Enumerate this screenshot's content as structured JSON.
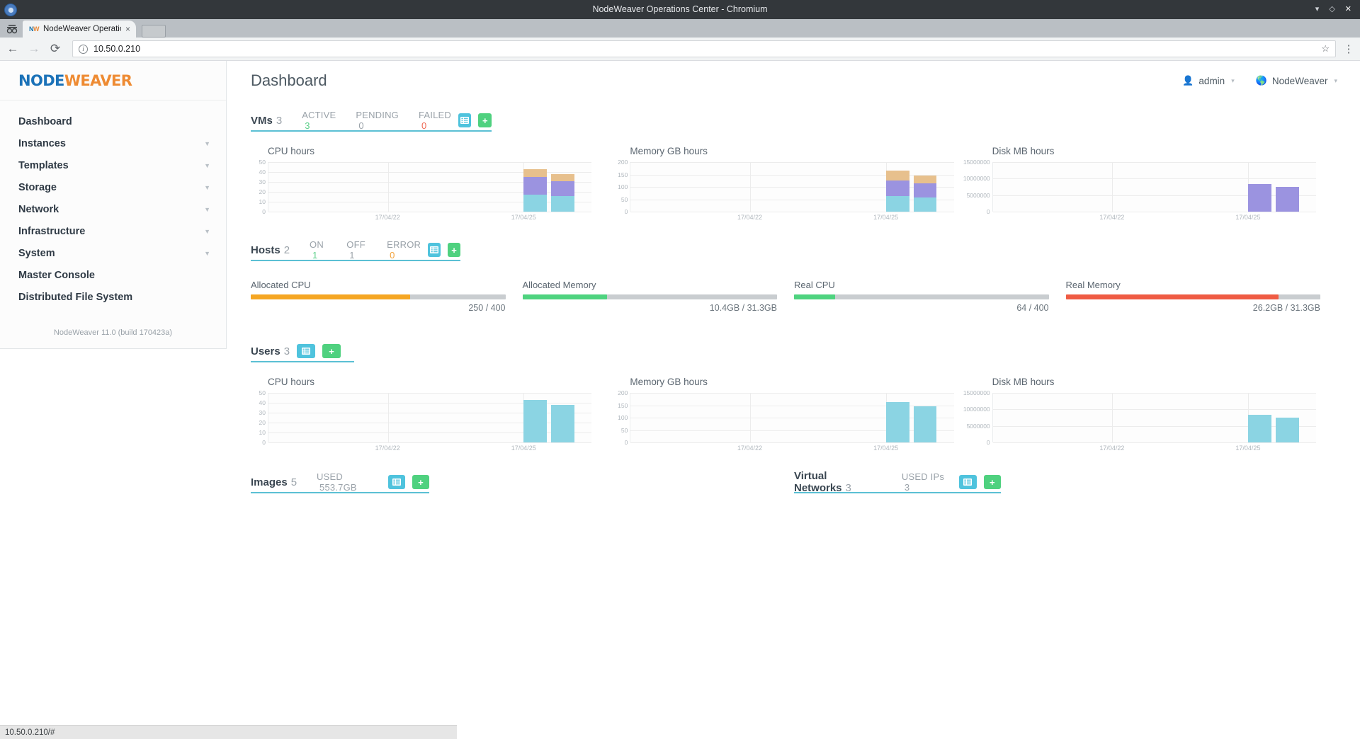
{
  "window": {
    "title": "NodeWeaver Operations Center - Chromium",
    "minimize_icon": "minimize-icon",
    "maximize_icon": "maximize-icon",
    "close_icon": "close-icon"
  },
  "browser": {
    "tab_title": "NodeWeaver Operatic",
    "favicon_text_a": "NW",
    "favicon_text_b": "W",
    "tab_close": "×",
    "back": "←",
    "forward": "→",
    "reload": "⟳",
    "url": "10.50.0.210",
    "info_icon": "i",
    "star": "☆",
    "menu": "⋮",
    "status_url": "10.50.0.210/#"
  },
  "sidebar": {
    "logo_a": "NODE",
    "logo_b": "WEAVER",
    "items": [
      {
        "label": "Dashboard",
        "expandable": false
      },
      {
        "label": "Instances",
        "expandable": true
      },
      {
        "label": "Templates",
        "expandable": true
      },
      {
        "label": "Storage",
        "expandable": true
      },
      {
        "label": "Network",
        "expandable": true
      },
      {
        "label": "Infrastructure",
        "expandable": true
      },
      {
        "label": "System",
        "expandable": true
      },
      {
        "label": "Master Console",
        "expandable": false
      },
      {
        "label": "Distributed File System",
        "expandable": false
      }
    ],
    "footer": "NodeWeaver 11.0 (build 170423a)"
  },
  "header": {
    "title": "Dashboard",
    "user": "admin",
    "zone": "NodeWeaver",
    "caret": "▾"
  },
  "buttons": {
    "list_label": "list-view",
    "add_label": "+"
  },
  "sections": {
    "vms": {
      "title": "VMs",
      "count": "3",
      "stats": [
        {
          "label": "ACTIVE",
          "value": "3",
          "color": "green"
        },
        {
          "label": "PENDING",
          "value": "0",
          "color": "gray"
        },
        {
          "label": "FAILED",
          "value": "0",
          "color": "red"
        }
      ]
    },
    "hosts": {
      "title": "Hosts",
      "count": "2",
      "stats": [
        {
          "label": "ON",
          "value": "1",
          "color": "green"
        },
        {
          "label": "OFF",
          "value": "1",
          "color": "gray"
        },
        {
          "label": "ERROR",
          "value": "0",
          "color": "orange"
        }
      ],
      "gauges": [
        {
          "label": "Allocated CPU",
          "value": "250 / 400",
          "percent": 62.5,
          "color": "#f5a623"
        },
        {
          "label": "Allocated Memory",
          "value": "10.4GB / 31.3GB",
          "percent": 33.2,
          "color": "#4ed37f"
        },
        {
          "label": "Real CPU",
          "value": "64 / 400",
          "percent": 16.0,
          "color": "#4ed37f"
        },
        {
          "label": "Real Memory",
          "value": "26.2GB / 31.3GB",
          "percent": 83.7,
          "color": "#ef5b43"
        }
      ]
    },
    "users": {
      "title": "Users",
      "count": "3",
      "stats": []
    },
    "images": {
      "title": "Images",
      "count": "5",
      "stats": [
        {
          "label": "USED",
          "value": "553.7GB",
          "color": "gray"
        }
      ]
    },
    "networks": {
      "title": "Virtual Networks",
      "count": "3",
      "stats": [
        {
          "label": "USED IPs",
          "value": "3",
          "color": "gray"
        }
      ]
    }
  },
  "chart_data": [
    {
      "id": "vms-cpu",
      "type": "bar",
      "stacked": true,
      "title": "CPU hours",
      "xlabel": "",
      "ylabel": "",
      "ylim": [
        0,
        50
      ],
      "yticks": [
        0,
        10,
        20,
        30,
        40,
        50
      ],
      "x": [
        "17/04/22",
        "17/04/25"
      ],
      "xtick_positions": [
        0.37,
        0.79
      ],
      "grid": true,
      "legend": "none",
      "bars": [
        {
          "x_frac": 0.79,
          "series": [
            {
              "name": "series-1",
              "value": 17,
              "color": "#8bd4e3"
            },
            {
              "name": "series-2",
              "value": 18,
              "color": "#9b93e0"
            },
            {
              "name": "series-3",
              "value": 8,
              "color": "#e7c08d"
            }
          ]
        },
        {
          "x_frac": 0.875,
          "series": [
            {
              "name": "series-1",
              "value": 16,
              "color": "#8bd4e3"
            },
            {
              "name": "series-2",
              "value": 15,
              "color": "#9b93e0"
            },
            {
              "name": "series-3",
              "value": 7,
              "color": "#e7c08d"
            }
          ]
        }
      ]
    },
    {
      "id": "vms-memory",
      "type": "bar",
      "stacked": true,
      "title": "Memory GB hours",
      "xlabel": "",
      "ylabel": "",
      "ylim": [
        0,
        200
      ],
      "yticks": [
        0,
        50,
        100,
        150,
        200
      ],
      "x": [
        "17/04/22",
        "17/04/25"
      ],
      "xtick_positions": [
        0.37,
        0.79
      ],
      "grid": true,
      "legend": "none",
      "bars": [
        {
          "x_frac": 0.79,
          "series": [
            {
              "name": "series-1",
              "value": 62,
              "color": "#8bd4e3"
            },
            {
              "name": "series-2",
              "value": 65,
              "color": "#9b93e0"
            },
            {
              "name": "series-3",
              "value": 38,
              "color": "#e7c08d"
            }
          ]
        },
        {
          "x_frac": 0.875,
          "series": [
            {
              "name": "series-1",
              "value": 58,
              "color": "#8bd4e3"
            },
            {
              "name": "series-2",
              "value": 55,
              "color": "#9b93e0"
            },
            {
              "name": "series-3",
              "value": 32,
              "color": "#e7c08d"
            }
          ]
        }
      ]
    },
    {
      "id": "vms-disk",
      "type": "bar",
      "stacked": true,
      "title": "Disk MB hours",
      "xlabel": "",
      "ylabel": "",
      "ylim": [
        0,
        15000000
      ],
      "yticks": [
        0,
        5000000,
        10000000,
        15000000
      ],
      "ytick_labels": [
        "0",
        "5000000",
        "10000000",
        "15000000"
      ],
      "x": [
        "17/04/22",
        "17/04/25"
      ],
      "xtick_positions": [
        0.37,
        0.79
      ],
      "grid": true,
      "legend": "none",
      "bars": [
        {
          "x_frac": 0.79,
          "series": [
            {
              "name": "series-2",
              "value": 8400000,
              "color": "#9b93e0"
            }
          ]
        },
        {
          "x_frac": 0.875,
          "series": [
            {
              "name": "series-2",
              "value": 7600000,
              "color": "#9b93e0"
            }
          ]
        }
      ]
    },
    {
      "id": "users-cpu",
      "type": "bar",
      "stacked": false,
      "title": "CPU hours",
      "xlabel": "",
      "ylabel": "",
      "ylim": [
        0,
        50
      ],
      "yticks": [
        0,
        10,
        20,
        30,
        40,
        50
      ],
      "x": [
        "17/04/22",
        "17/04/25"
      ],
      "xtick_positions": [
        0.37,
        0.79
      ],
      "grid": true,
      "legend": "none",
      "bars": [
        {
          "x_frac": 0.79,
          "series": [
            {
              "name": "series-1",
              "value": 43,
              "color": "#8bd4e3"
            }
          ]
        },
        {
          "x_frac": 0.875,
          "series": [
            {
              "name": "series-1",
              "value": 38,
              "color": "#8bd4e3"
            }
          ]
        }
      ]
    },
    {
      "id": "users-memory",
      "type": "bar",
      "stacked": false,
      "title": "Memory GB hours",
      "xlabel": "",
      "ylabel": "",
      "ylim": [
        0,
        200
      ],
      "yticks": [
        0,
        50,
        100,
        150,
        200
      ],
      "x": [
        "17/04/22",
        "17/04/25"
      ],
      "xtick_positions": [
        0.37,
        0.79
      ],
      "grid": true,
      "legend": "none",
      "bars": [
        {
          "x_frac": 0.79,
          "series": [
            {
              "name": "series-1",
              "value": 163,
              "color": "#8bd4e3"
            }
          ]
        },
        {
          "x_frac": 0.875,
          "series": [
            {
              "name": "series-1",
              "value": 146,
              "color": "#8bd4e3"
            }
          ]
        }
      ]
    },
    {
      "id": "users-disk",
      "type": "bar",
      "stacked": false,
      "title": "Disk MB hours",
      "xlabel": "",
      "ylabel": "",
      "ylim": [
        0,
        15000000
      ],
      "yticks": [
        0,
        5000000,
        10000000,
        15000000
      ],
      "ytick_labels": [
        "0",
        "5000000",
        "10000000",
        "15000000"
      ],
      "x": [
        "17/04/22",
        "17/04/25"
      ],
      "xtick_positions": [
        0.37,
        0.79
      ],
      "grid": true,
      "legend": "none",
      "bars": [
        {
          "x_frac": 0.79,
          "series": [
            {
              "name": "series-1",
              "value": 8300000,
              "color": "#8bd4e3"
            }
          ]
        },
        {
          "x_frac": 0.875,
          "series": [
            {
              "name": "series-1",
              "value": 7500000,
              "color": "#8bd4e3"
            }
          ]
        }
      ]
    }
  ]
}
